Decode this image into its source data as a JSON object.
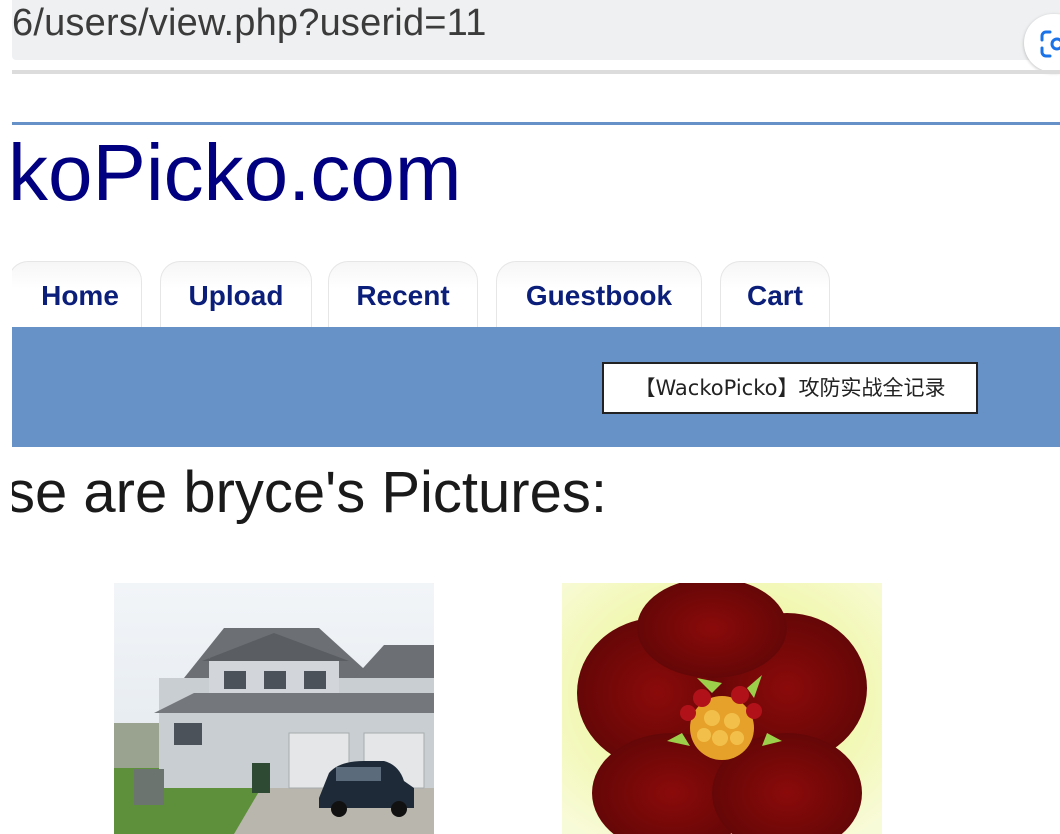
{
  "browser": {
    "address_text": "6/users/view.php?userid=11",
    "lens_icon": "google-lens-icon"
  },
  "site": {
    "title": "koPicko.com"
  },
  "nav": {
    "tabs": [
      {
        "label": "Home"
      },
      {
        "label": "Upload"
      },
      {
        "label": "Recent"
      },
      {
        "label": "Guestbook"
      },
      {
        "label": "Cart"
      }
    ]
  },
  "overlay": {
    "tooltip_text": "【WackoPicko】攻防实战全记录"
  },
  "main": {
    "heading": "se are bryce's Pictures:",
    "pictures": [
      {
        "icon": "house-photo"
      },
      {
        "icon": "flower-photo"
      }
    ]
  },
  "colors": {
    "title_blue": "#000080",
    "tab_text": "#0b1f7a",
    "band_blue": "#6692c8",
    "address_bg": "#eef0f1"
  }
}
